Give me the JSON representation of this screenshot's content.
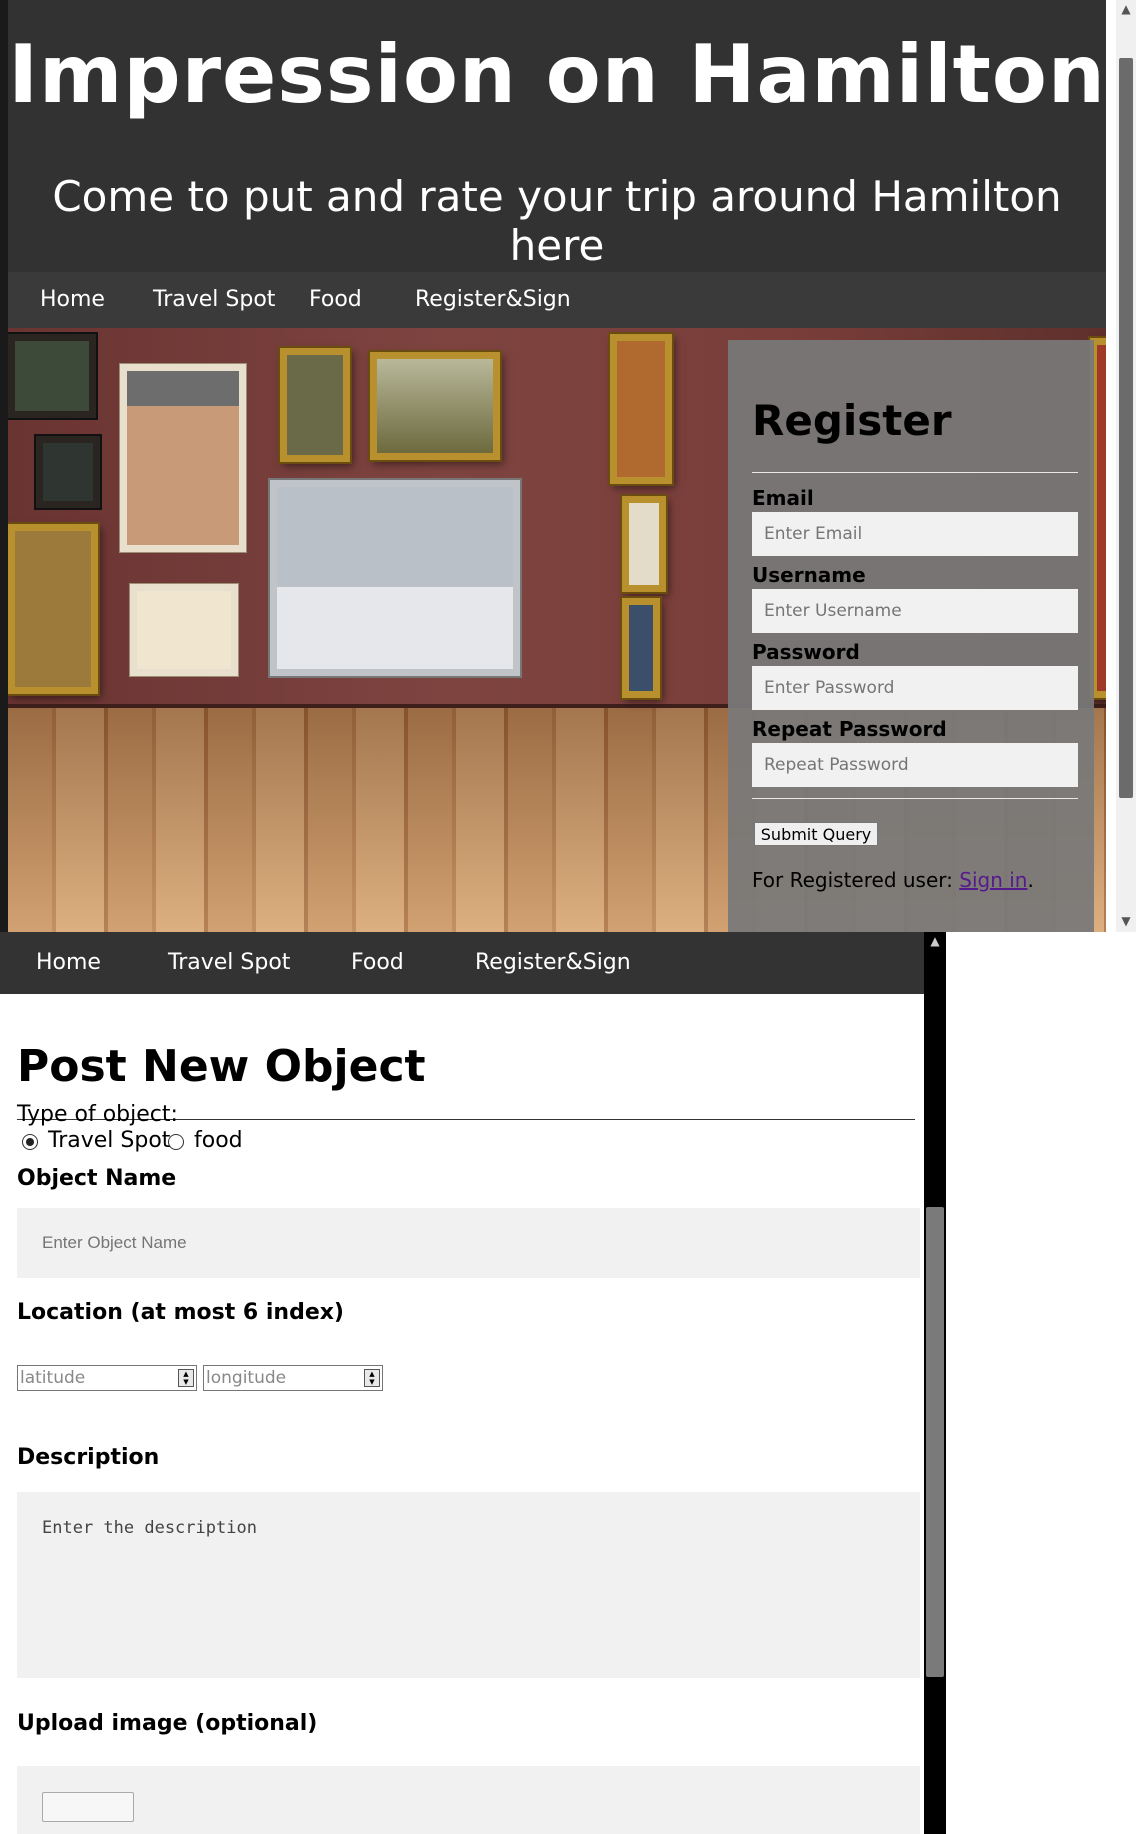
{
  "site": {
    "title": "Impression on Hamilton",
    "subtitle": "Come to put and rate your trip around Hamilton here"
  },
  "nav": {
    "items": [
      {
        "label": "Home"
      },
      {
        "label": "Travel Spot"
      },
      {
        "label": "Food"
      },
      {
        "label": "Register&Sign"
      }
    ]
  },
  "register": {
    "heading": "Register",
    "email_label": "Email",
    "email_placeholder": "Enter Email",
    "username_label": "Username",
    "username_placeholder": "Enter Username",
    "password_label": "Password",
    "password_placeholder": "Enter Password",
    "repeat_label": "Repeat Password",
    "repeat_placeholder": "Repeat Password",
    "submit_label": "Submit Query",
    "signin_prefix": "For Registered user: ",
    "signin_link": "Sign in",
    "signin_suffix": "."
  },
  "post": {
    "heading": "Post New Object",
    "type_label": "Type of object:",
    "type_options": [
      {
        "label": "Travel Spot",
        "checked": true
      },
      {
        "label": "food",
        "checked": false
      }
    ],
    "name_label": "Object Name",
    "name_placeholder": "Enter Object Name",
    "location_label": "Location (at most 6 index)",
    "latitude_placeholder": "latitude",
    "longitude_placeholder": "longitude",
    "description_label": "Description",
    "description_placeholder": "Enter the description",
    "upload_label": "Upload image (optional)"
  },
  "colors": {
    "header_bg": "#333232",
    "nav_bg": "#3a3a3a",
    "register_panel": "#787878",
    "link": "#551a8b",
    "input_bg": "#f1f1f1"
  }
}
